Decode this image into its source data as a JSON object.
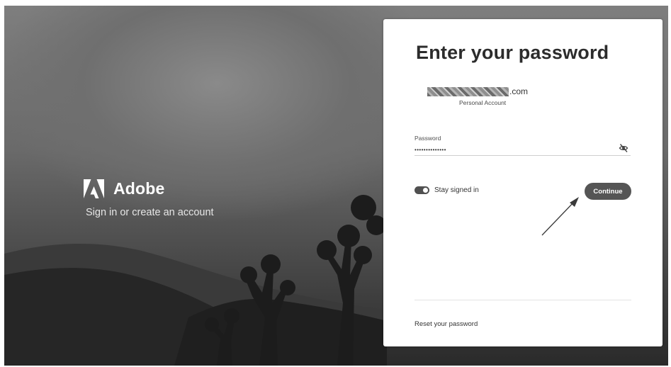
{
  "brand": {
    "name": "Adobe",
    "tagline": "Sign in or create an account"
  },
  "signin": {
    "title": "Enter your password",
    "email_suffix": ".com",
    "account_type": "Personal Account",
    "password_label": "Password",
    "password_value": "••••••••••••••",
    "show_password_icon": "eye-slash-icon",
    "stay_signed_in_label": "Stay signed in",
    "stay_signed_in": true,
    "continue_label": "Continue",
    "reset_link": "Reset your password"
  },
  "colors": {
    "button": "#555555",
    "card": "#ffffff"
  }
}
